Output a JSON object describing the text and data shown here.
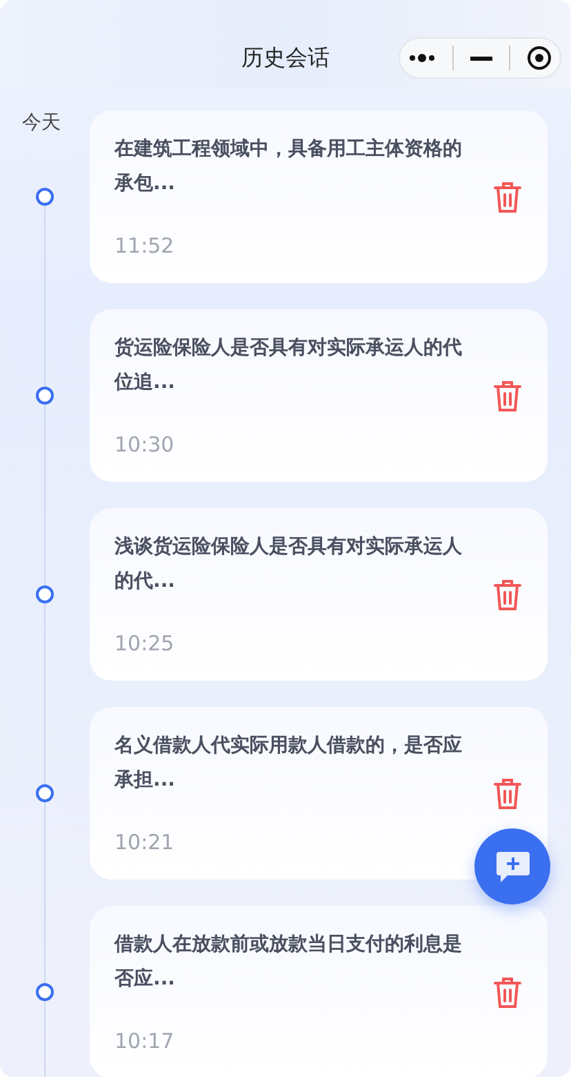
{
  "header": {
    "title": "历史会话"
  },
  "date_label": "今天",
  "sessions": [
    {
      "title": "在建筑工程领域中，具备用工主体资格的承包...",
      "time": "11:52"
    },
    {
      "title": "货运险保险人是否具有对实际承运人的代位追...",
      "time": "10:30"
    },
    {
      "title": "浅谈货运险保险人是否具有对实际承运人的代...",
      "time": "10:25"
    },
    {
      "title": "名义借款人代实际用款人借款的，是否应承担...",
      "time": "10:21"
    },
    {
      "title": "借款人在放款前或放款当日支付的利息是否应...",
      "time": "10:17"
    }
  ]
}
